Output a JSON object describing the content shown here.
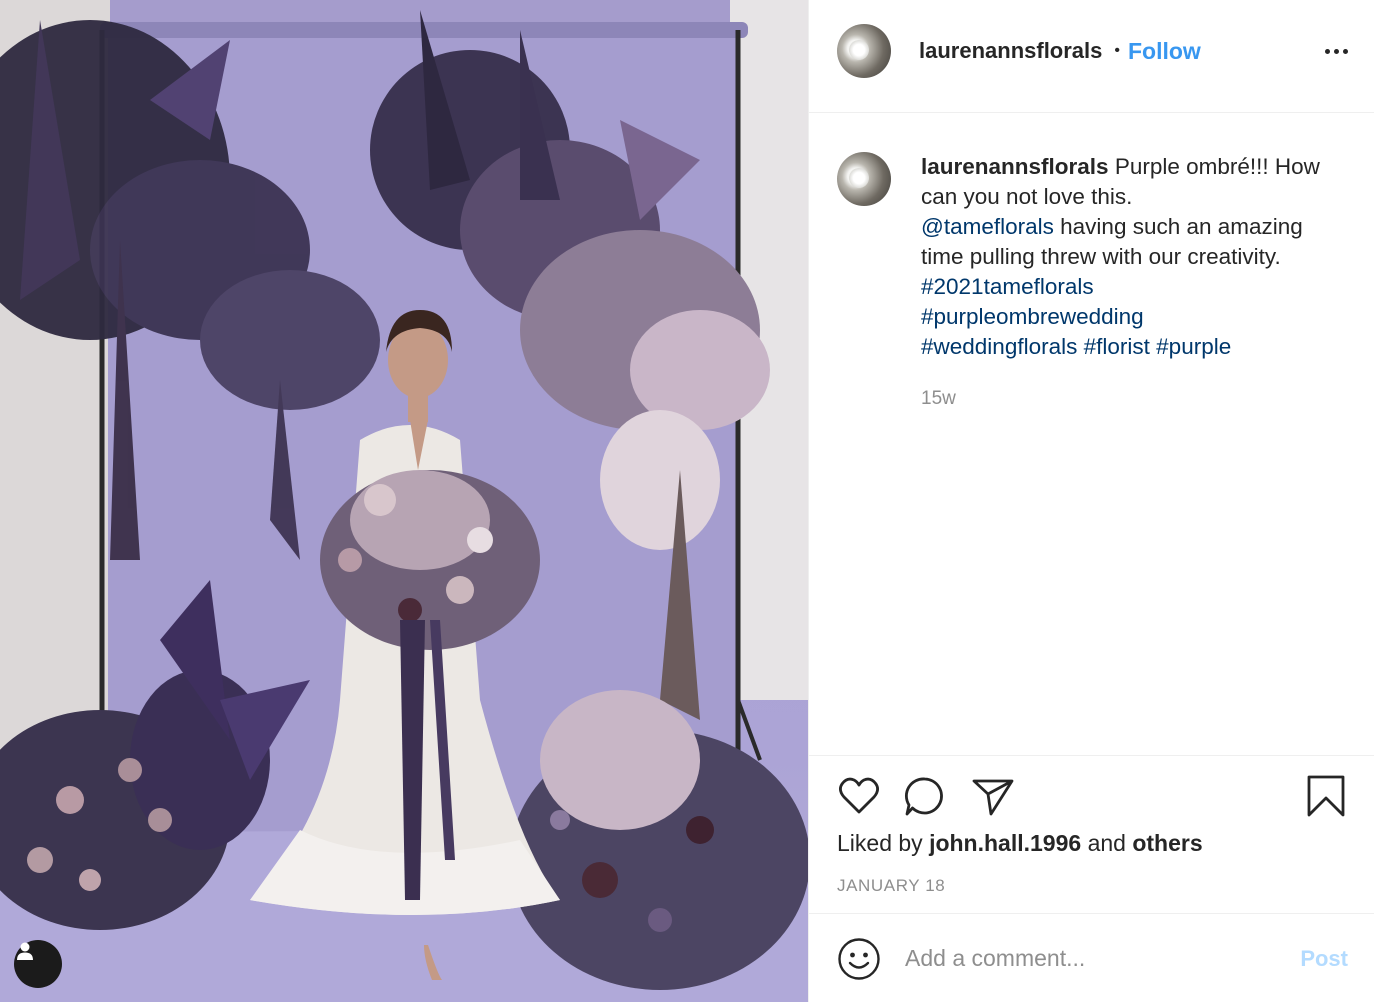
{
  "post": {
    "username": "laurenannsflorals",
    "separator": "•",
    "follow_label": "Follow",
    "more_label": "More options"
  },
  "caption": {
    "username": "laurenannsflorals",
    "text_before": "Purple ombré!!! How can you not love this.",
    "mention": "@tameflorals",
    "text_after": "having such an amazing time pulling threw with our creativity.",
    "hashtags": [
      "#2021tameflorals",
      "#purpleombrewedding",
      "#weddingflorals",
      "#florist",
      "#purple"
    ],
    "time_ago": "15w"
  },
  "actions": {
    "icons": [
      "heart-icon",
      "comment-icon",
      "share-icon",
      "bookmark-icon"
    ]
  },
  "likes": {
    "prefix": "Liked by",
    "user": "john.hall.1996",
    "middle": "and",
    "others": "others"
  },
  "date": "JANUARY 18",
  "comment": {
    "placeholder": "Add a comment...",
    "post_label": "Post",
    "emoji_icon": "smiley-icon"
  },
  "colors": {
    "accent": "#3897f0",
    "link": "#00376b",
    "muted": "#8e8e8e",
    "post_disabled": "#b3dbff",
    "backdrop": "#aaa2d4"
  }
}
